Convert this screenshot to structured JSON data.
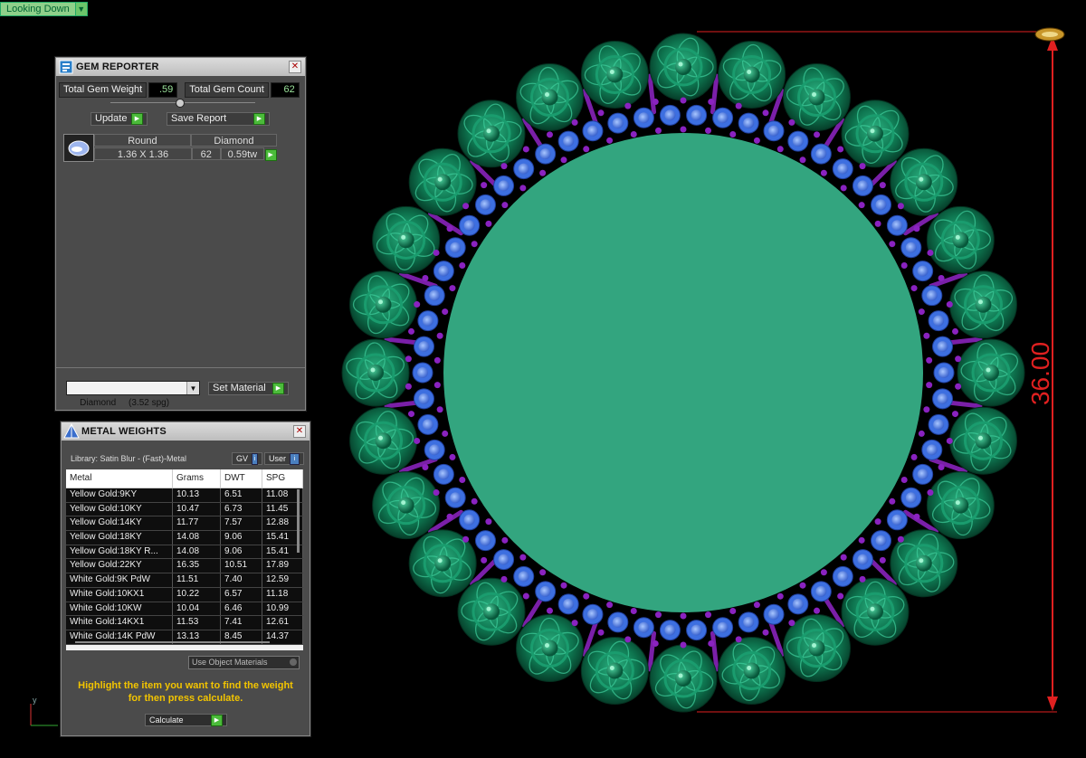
{
  "view": {
    "mode": "Looking Down"
  },
  "gem_reporter": {
    "title": "GEM REPORTER",
    "total_weight_label": "Total Gem Weight",
    "total_weight_value": ".59",
    "total_count_label": "Total Gem Count",
    "total_count_value": "62",
    "update_label": "Update",
    "save_label": "Save Report",
    "table": {
      "shape_header": "Round",
      "material_header": "Diamond",
      "size": "1.36 X 1.36",
      "count": "62",
      "weight": "0.59tw"
    },
    "material_select": "Diamond     (3.52 spg)",
    "set_material_label": "Set Material"
  },
  "metal_weights": {
    "title": "METAL WEIGHTS",
    "library": "Library: Satin Blur - (Fast)-Metal",
    "gv_label": "GV",
    "user_label": "User",
    "columns": [
      "Metal",
      "Grams",
      "DWT",
      "SPG"
    ],
    "rows": [
      [
        "Yellow Gold:9KY",
        "10.13",
        "6.51",
        "11.08"
      ],
      [
        "Yellow Gold:10KY",
        "10.47",
        "6.73",
        "11.45"
      ],
      [
        "Yellow Gold:14KY",
        "11.77",
        "7.57",
        "12.88"
      ],
      [
        "Yellow Gold:18KY",
        "14.08",
        "9.06",
        "15.41"
      ],
      [
        "Yellow Gold:18KY R...",
        "14.08",
        "9.06",
        "15.41"
      ],
      [
        "Yellow Gold:22KY",
        "16.35",
        "10.51",
        "17.89"
      ],
      [
        "White Gold:9K PdW",
        "11.51",
        "7.40",
        "12.59"
      ],
      [
        "White Gold:10KX1",
        "10.22",
        "6.57",
        "11.18"
      ],
      [
        "White Gold:10KW",
        "10.04",
        "6.46",
        "10.99"
      ],
      [
        "White Gold:14KX1",
        "11.53",
        "7.41",
        "12.61"
      ],
      [
        "White Gold:14K PdW",
        "13.13",
        "8.45",
        "14.37"
      ]
    ],
    "use_object_label": "Use Object Materials",
    "hint": "Highlight the item you want to find the weight for then press calculate.",
    "calculate_label": "Calculate"
  },
  "dimension": {
    "value": "36.00"
  },
  "axis": {
    "y": "y"
  },
  "colors": {
    "center": "#33a57f",
    "rose": "#0f7a55",
    "blue_gem": "#4d7ee6",
    "purple": "#7a1fa8",
    "dimension": "#e02020"
  }
}
